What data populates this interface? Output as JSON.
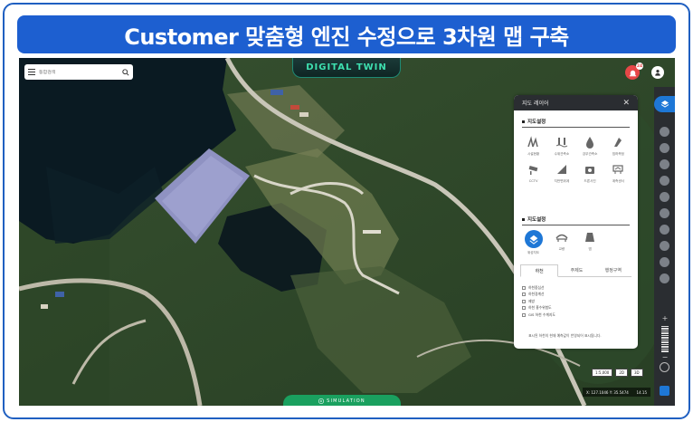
{
  "banner": {
    "title": "Customer 맞춤형 엔진 수정으로 3차원 맵 구축"
  },
  "search": {
    "placeholder": "통합검색"
  },
  "header": {
    "app_title": "DIGITAL TWIN",
    "alarm_count": "24"
  },
  "bottom_bar": {
    "label": "SIMULATION"
  },
  "layer_panel": {
    "title": "지도 레이어",
    "section1_title": "지도설정",
    "section1_items": [
      {
        "label": "시설현황",
        "icon": "facility-icon"
      },
      {
        "label": "수위관측소",
        "icon": "water-gauge-icon"
      },
      {
        "label": "강우관측소",
        "icon": "rain-gauge-icon"
      },
      {
        "label": "침하측정",
        "icon": "settlement-icon"
      },
      {
        "label": "CCTV",
        "icon": "cctv-icon"
      },
      {
        "label": "지반변위계",
        "icon": "ground-displacement-icon"
      },
      {
        "label": "드론사진",
        "icon": "drone-photo-icon"
      },
      {
        "label": "계측센서",
        "icon": "sensor-icon"
      }
    ],
    "section2_title": "지도설정",
    "section2_items": [
      {
        "label": "위성지도",
        "icon": "satellite-icon",
        "active": true
      },
      {
        "label": "교량",
        "icon": "bridge-icon",
        "active": false
      },
      {
        "label": "댐",
        "icon": "dam-icon",
        "active": false
      }
    ],
    "tabs": [
      {
        "label": "하천",
        "active": true
      },
      {
        "label": "주제도",
        "active": false
      },
      {
        "label": "행정구역",
        "active": false
      }
    ],
    "checkboxes": [
      "하천중심선",
      "하천경계선",
      "제방",
      "하천 홍수위험도",
      "GIS 하천 수계지도"
    ],
    "note": "표시된 하천의 현재 예측값이 반영되어 표시됩니다."
  },
  "map_controls": {
    "scale_buttons": [
      "1:5,000",
      "2D",
      "3D"
    ],
    "coordinate": "X: 127.1046 Y: 35.5474",
    "zoom_level": "14.15",
    "zoom_plus": "+",
    "zoom_minus": "−"
  },
  "colors": {
    "brand": "#1d5fd0",
    "accent": "#1e77d6",
    "digital_twin": "#3ee0b0",
    "simulation": "#1aa05f"
  }
}
